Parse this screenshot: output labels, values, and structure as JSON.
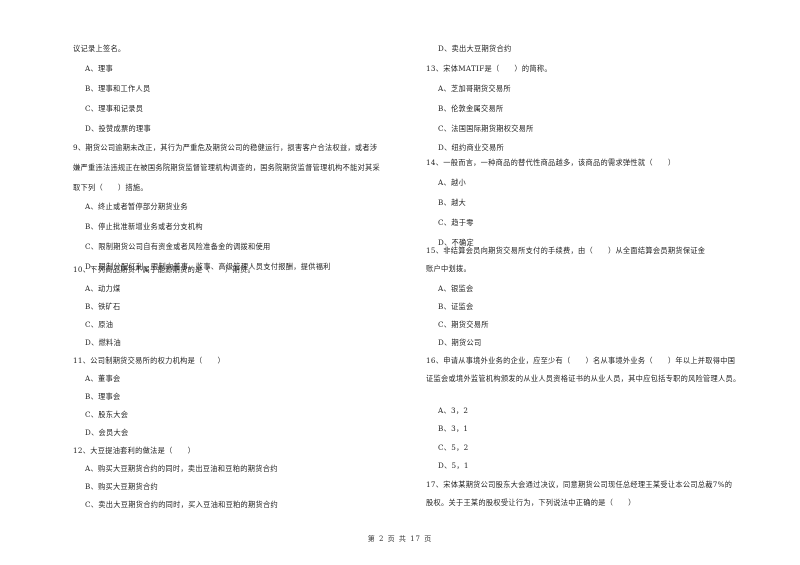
{
  "left_column": {
    "q8_tail": "议记录上签名。",
    "q8_options": [
      "A、理事",
      "B、理事和工作人员",
      "C、理事和记录员",
      "D、投赞成票的理事"
    ],
    "q9_lines": [
      "9、期货公司逾期未改正，其行为严重危及期货公司的稳健运行，损害客户合法权益，或者涉",
      "嫌严重违法违规正在被国务院期货监督管理机构调查的，国务院期货监督管理机构不能对其采",
      "取下列（　　）措施。"
    ],
    "q9_options": [
      "A、终止或者暂停部分期货业务",
      "B、停止批准新增业务或者分支机构",
      "C、限制期货公司自有资金或者风险准备金的调拨和使用",
      "D、限制分配红利，限制向董事、监事、高级管理人员支付报酬，提供福利"
    ],
    "q10": "10、下列商品期货不属于能源期货的是（　　）期货。",
    "q10_options": [
      "A、动力煤",
      "B、铁矿石",
      "C、原油",
      "D、燃料油"
    ],
    "q11": "11、公司制期货交易所的权力机构是（　　）",
    "q11_options": [
      "A、董事会",
      "B、理事会",
      "C、股东大会",
      "D、会员大会"
    ],
    "q12": "12、大豆提油套利的做法是（　　）",
    "q12_options": [
      "A、购买大豆期货合约的同时，卖出豆油和豆粕的期货合约",
      "B、购买大豆期货合约",
      "C、卖出大豆期货合约的同时，买入豆油和豆粕的期货合约"
    ]
  },
  "right_column": {
    "q12_option_d": "D、卖出大豆期货合约",
    "q13": "13、宋体MATIF是（　　）的简称。",
    "q13_options": [
      "A、芝加哥期货交易所",
      "B、伦敦金属交易所",
      "C、法国国际期货期权交易所",
      "D、纽约商业交易所"
    ],
    "q14": "14、一般而言，一种商品的替代性商品越多，该商品的需求弹性就（　　）",
    "q14_options": [
      "A、越小",
      "B、越大",
      "C、趋于零",
      "D、不确定"
    ],
    "q15_lines": [
      "15、非结算会员向期货交易所支付的手续费，由（　　）从全面结算会员期货保证金",
      "账户中划拨。"
    ],
    "q15_options": [
      "A、银监会",
      "B、证监会",
      "C、期货交易所",
      "D、期货公司"
    ],
    "q16_lines": [
      "16、申请从事境外业务的企业，应至少有（　　）名从事境外业务（　　）年以上并取得中国",
      "证监会或境外监管机构颁发的从业人员资格证书的从业人员，其中应包括专职的风险管理人员。"
    ],
    "q16_options": [
      "A、3，2",
      "B、3，1",
      "C、5，2",
      "D、5，1"
    ],
    "q17_lines": [
      "17、宋体某期货公司股东大会通过决议，同意期货公司现任总经理王某受让本公司总裁7%的",
      "股权。关于王某的股权受让行为，下列说法中正确的是（　　）"
    ]
  },
  "footer": {
    "page_label": "第 2 页 共 17 页"
  }
}
